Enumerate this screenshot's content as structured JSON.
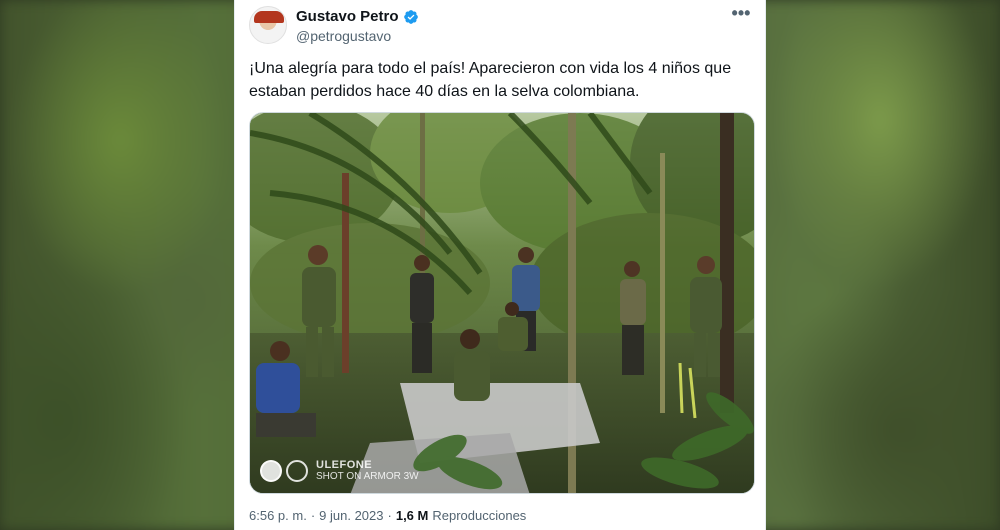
{
  "tweet": {
    "author_name": "Gustavo Petro",
    "author_handle": "@petrogustavo",
    "more_icon": "•••",
    "text": "¡Una alegría para todo el país! Aparecieron con vida los 4 niños que estaban perdidos hace 40 días en la selva colombiana.",
    "time": "6:56 p. m.",
    "separator": "·",
    "date": "9 jun. 2023",
    "views_count": "1,6 M",
    "views_label": "Reproducciones"
  },
  "media": {
    "watermark_brand": "ULEFONE",
    "watermark_sub": "SHOT ON ARMOR 3W"
  },
  "colors": {
    "verified": "#1d9bf0",
    "text_primary": "#0f1419",
    "text_secondary": "#536471"
  }
}
